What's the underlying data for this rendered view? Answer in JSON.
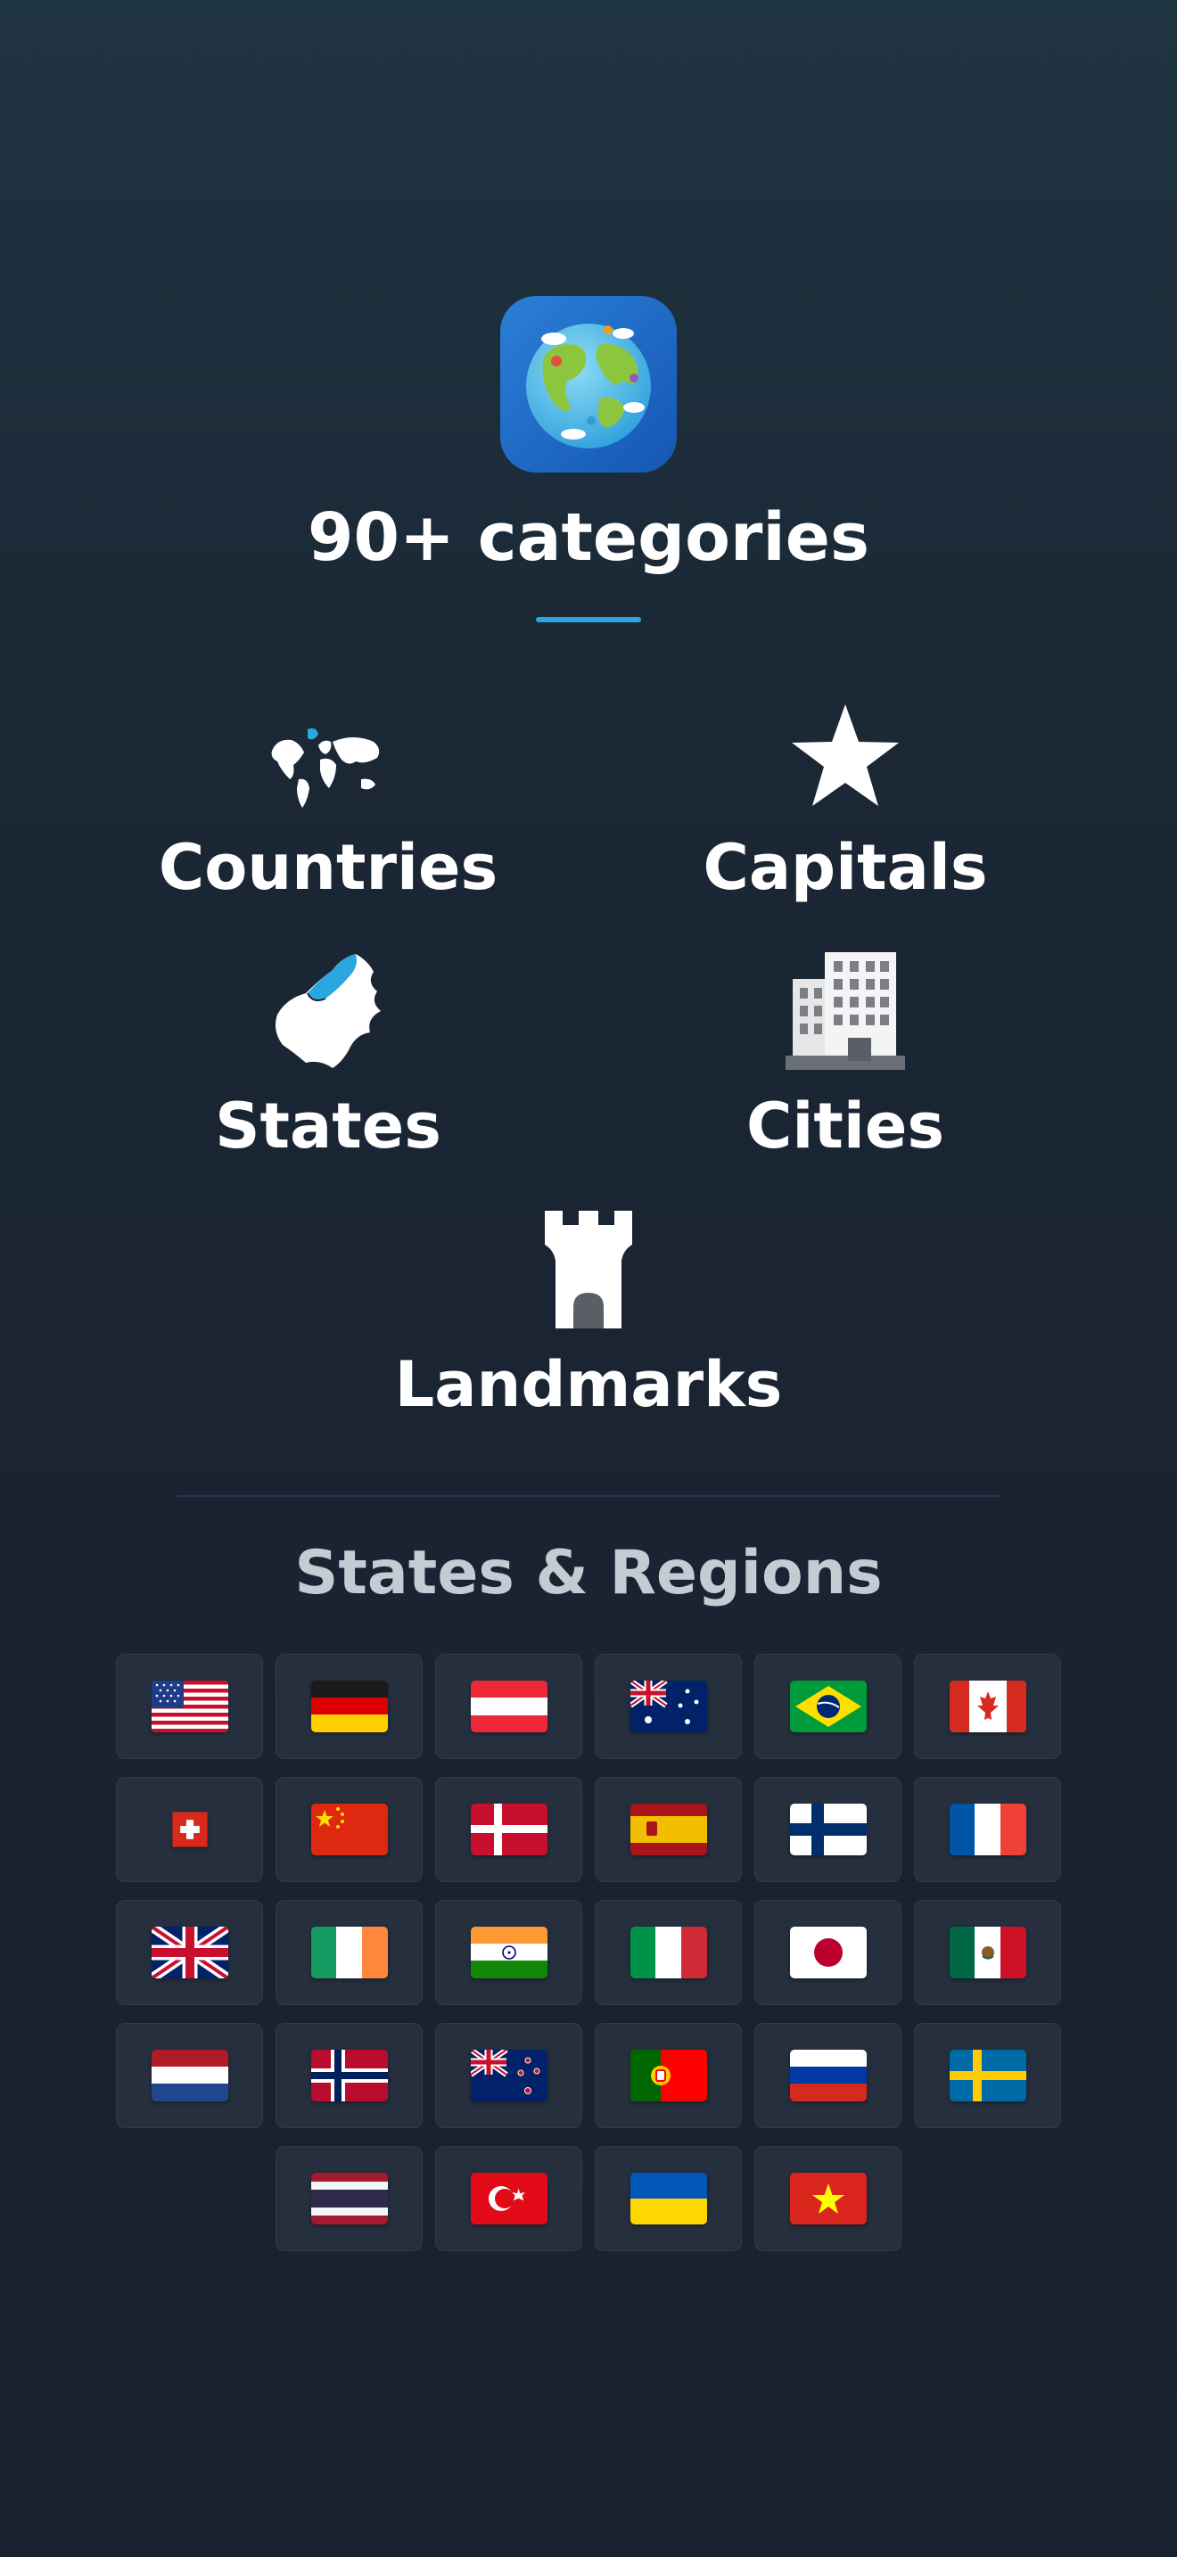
{
  "header": {
    "title": "90+ categories",
    "accent_color": "#2aa7e0",
    "app_icon": "globe-app-icon"
  },
  "categories": [
    {
      "label": "Countries",
      "icon": "world-map-icon"
    },
    {
      "label": "Capitals",
      "icon": "star-icon"
    },
    {
      "label": "States",
      "icon": "state-map-icon"
    },
    {
      "label": "Cities",
      "icon": "building-icon"
    },
    {
      "label": "Landmarks",
      "icon": "castle-tower-icon"
    }
  ],
  "states_section": {
    "title": "States & Regions",
    "flags": [
      "us",
      "de",
      "at",
      "au",
      "br",
      "ca",
      "ch",
      "cn",
      "dk",
      "es",
      "fi",
      "fr",
      "gb",
      "ie",
      "in",
      "it",
      "jp",
      "mx",
      "nl",
      "no",
      "nz",
      "pt",
      "ru",
      "se",
      "th",
      "tr",
      "ua",
      "vn"
    ]
  }
}
